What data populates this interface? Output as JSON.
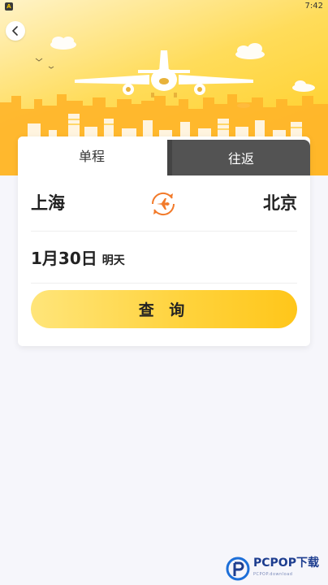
{
  "status_bar": {
    "time": "7:42",
    "app_icon": "A"
  },
  "header": {
    "back_icon": "chevron-left-icon"
  },
  "tabs": [
    {
      "label": "单程",
      "active": true
    },
    {
      "label": "往返",
      "active": false
    }
  ],
  "route": {
    "from_city": "上海",
    "to_city": "北京",
    "swap_icon": "plane-swap-icon"
  },
  "date": {
    "main": "1月30日",
    "sub": "明天"
  },
  "search_button": {
    "label": "查 询"
  },
  "watermark": {
    "brand": "PCPOP下载",
    "tagline": "PCPOP.download"
  },
  "colors": {
    "accent": "#ffcc1c",
    "swap_icon": "#f27a2a",
    "background": "#f6f6fb"
  }
}
